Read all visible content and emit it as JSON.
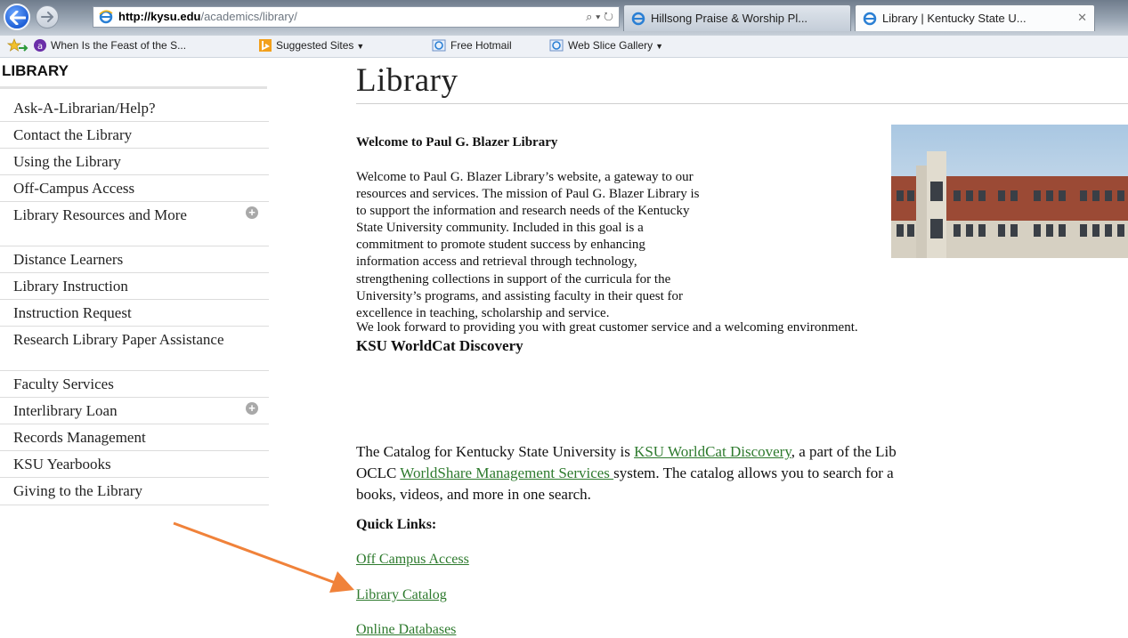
{
  "browser": {
    "url_domain": "http://kysu.edu",
    "url_path": "/academics/library/",
    "address_tools": "⌕ ▾ ↻",
    "tabs": [
      {
        "title": "Hillsong Praise & Worship Pl..."
      },
      {
        "title": "Library | Kentucky State U...",
        "close": "✕"
      }
    ],
    "favorites": [
      {
        "label": "When Is the Feast of the S..."
      },
      {
        "label": "Suggested Sites"
      },
      {
        "label": "Free Hotmail"
      },
      {
        "label": "Web Slice Gallery"
      }
    ],
    "colors": {
      "accent": "#1f5fd6",
      "chrome": "#eef1f6"
    }
  },
  "sidebar": {
    "heading": "LIBRARY",
    "items": [
      {
        "label": "Ask-A-Librarian/Help?"
      },
      {
        "label": "Contact the Library"
      },
      {
        "label": "Using the Library"
      },
      {
        "label": "Off-Campus Access"
      },
      {
        "label": "Library Resources and More",
        "expand": "+"
      },
      {
        "label": "Distance Learners"
      },
      {
        "label": "Library Instruction"
      },
      {
        "label": "Instruction Request"
      },
      {
        "label": "Research Library Paper Assistance"
      },
      {
        "label": "Faculty Services"
      },
      {
        "label": "Interlibrary Loan",
        "expand": "+"
      },
      {
        "label": "Records Management"
      },
      {
        "label": "KSU Yearbooks"
      },
      {
        "label": "Giving to the Library"
      }
    ]
  },
  "main": {
    "title": "Library",
    "welcome_heading": "Welcome to Paul G. Blazer Library",
    "welcome_lines": [
      "Welcome to Paul G. Blazer Library’s website, a gateway to our",
      "resources and services.  The mission of Paul G. Blazer Library is",
      "to support the information and research needs of the Kentucky",
      "State University community. Included in this goal is a",
      "commitment to promote student success by enhancing",
      "information access and retrieval through technology,",
      "strengthening collections in support of the curricula for the",
      "University’s programs, and assisting faculty in their quest for",
      "excellence in teaching, scholarship and service."
    ],
    "welcome_closing": "We look forward to providing you with great customer service and a welcoming environment.",
    "worldcat_heading": "KSU WorldCat Discovery",
    "catalog": {
      "l1_pre": "The Catalog for Kentucky State University is ",
      "l1_link": "KSU WorldCat Discovery",
      "l1_post": ", a part of the Lib",
      "l2_pre": "OCLC ",
      "l2_link": "WorldShare Management Services ",
      "l2_post": "system.  The catalog allows you to search for a",
      "l3": "books, videos, and more in one search."
    },
    "quick_links_heading": "Quick Links:",
    "quick_links": [
      {
        "label": "Off Campus Access"
      },
      {
        "label": "Library Catalog"
      },
      {
        "label": "Online Databases"
      }
    ],
    "link_color": "#2d7a2d",
    "annotation_color": "#f0823a"
  }
}
